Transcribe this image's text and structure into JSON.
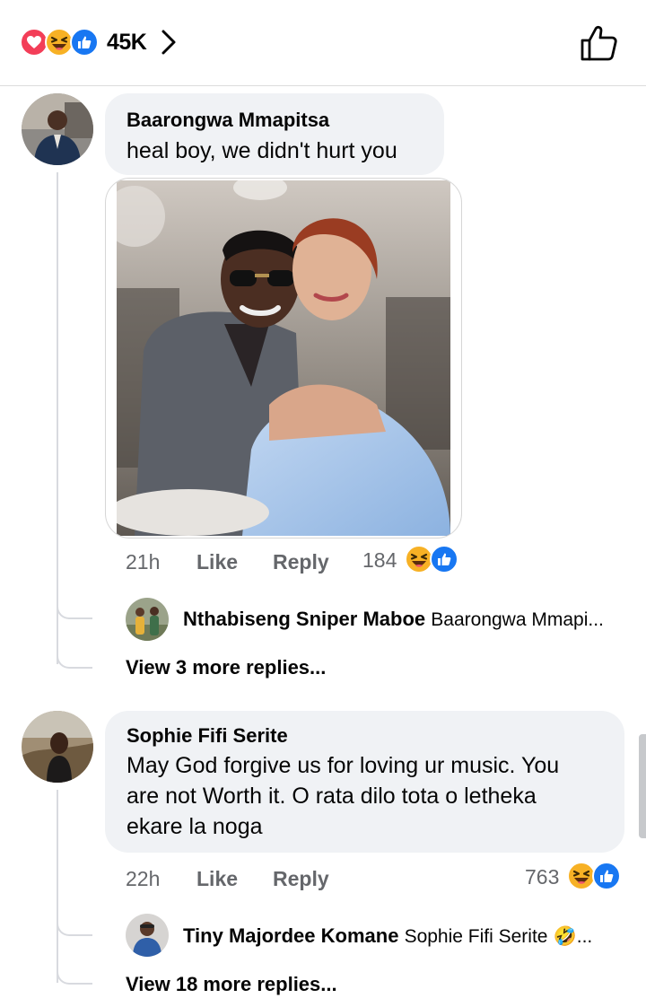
{
  "header": {
    "reaction_icons": [
      "love-icon",
      "haha-icon",
      "like-icon"
    ],
    "reaction_count": "45K",
    "chevron_icon": "chevron-right-icon",
    "like_icon": "thumbs-up-outline-icon"
  },
  "comments": [
    {
      "author": "Baarongwa Mmapitsa",
      "text": "heal boy, we didn't hurt you",
      "has_photo": true,
      "time": "21h",
      "like_label": "Like",
      "reply_label": "Reply",
      "reaction_count": "184",
      "reaction_icons": [
        "haha-icon",
        "like-icon"
      ],
      "reply_preview": {
        "author": "Nthabiseng Sniper Maboe",
        "text": "Baarongwa Mmapi..."
      },
      "view_more": "View 3 more replies..."
    },
    {
      "author": "Sophie Fifi Serite",
      "text_lines": [
        "May God forgive us for loving ur music. You",
        "are not Worth it. O rata dilo tota o letheka",
        "ekare la noga"
      ],
      "time": "22h",
      "like_label": "Like",
      "reply_label": "Reply",
      "reaction_count": "763",
      "reaction_icons": [
        "haha-icon",
        "like-icon"
      ],
      "reply_preview": {
        "author": "Tiny Majordee Komane",
        "text": "Sophie Fifi Serite",
        "emoji": "🤣",
        "suffix": "..."
      },
      "view_more": "View 18 more replies..."
    }
  ],
  "colors": {
    "love": "#f33e58",
    "haha": "#f7b125",
    "like": "#1877f2",
    "bubble": "#f0f2f5",
    "secondary_text": "#65676b"
  }
}
